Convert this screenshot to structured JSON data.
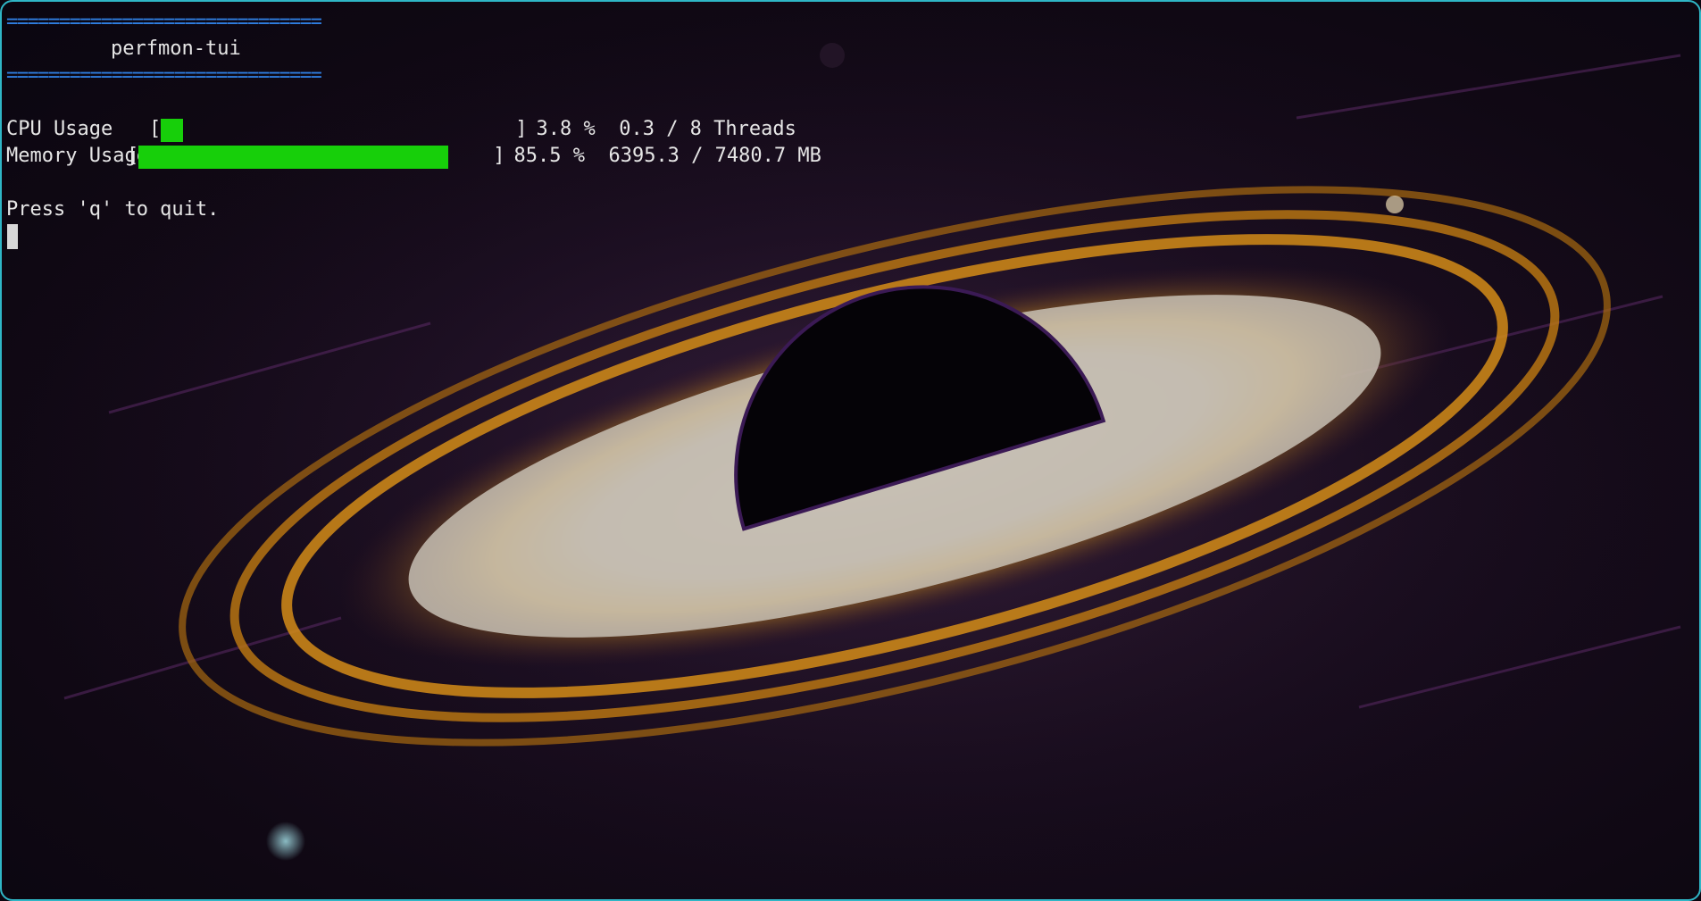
{
  "terminal": {
    "rule": "==============================",
    "title": "perfmon-tui",
    "cpu": {
      "label": "CPU Usage",
      "open_bracket": "[",
      "close_bracket": "]",
      "percent": 3.8,
      "text": "3.8 %  0.3 / 8 Threads"
    },
    "memory": {
      "label": "Memory Usage",
      "open_bracket": "[",
      "close_bracket": "]",
      "percent": 85.5,
      "text": "85.5 %  6395.3 / 7480.7 MB"
    },
    "quit_hint": "Press 'q' to quit."
  },
  "colors": {
    "bar_fill": "#17cf0a",
    "rule": "#2f7ee0",
    "text": "#e6e6e6",
    "window_border": "#2fb6c6"
  }
}
